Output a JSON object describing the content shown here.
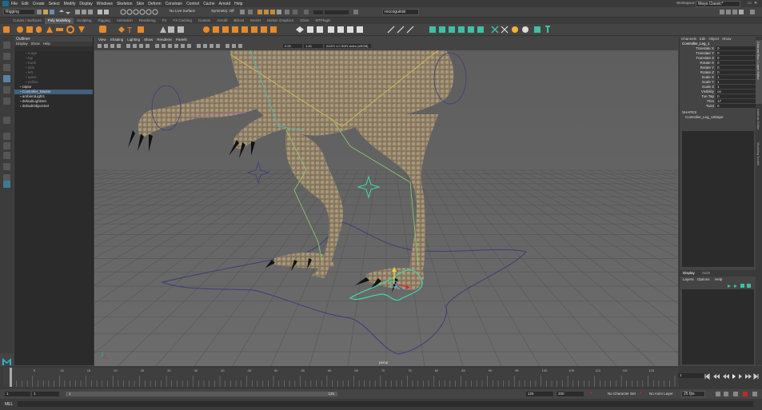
{
  "menubar": {
    "items": [
      "File",
      "Edit",
      "Create",
      "Select",
      "Modify",
      "Display",
      "Windows",
      "Skeleton",
      "Skin",
      "Deform",
      "Constrain",
      "Control",
      "Cache",
      "Arnold",
      "Help"
    ],
    "workspace_label": "Workspace:",
    "workspace_value": "Maya Classic*"
  },
  "statusline": {
    "mode": "Rigging",
    "live_surface": "No Live Surface",
    "symmetry": "Symmetry: Off",
    "render_user": "roccoguinisi"
  },
  "shelf": {
    "tabs": [
      "Curves / Surfaces",
      "Poly Modeling",
      "Sculpting",
      "Rigging",
      "Animation",
      "Rendering",
      "FX",
      "FX Caching",
      "Custom",
      "Arnold",
      "Bifrost",
      "MASH",
      "Motion Graphics",
      "XGen",
      "MTPlugin"
    ],
    "active_tab": "Poly Modeling"
  },
  "outliner": {
    "title": "Outliner",
    "menus": [
      "Display",
      "Show",
      "Help"
    ],
    "items": [
      {
        "label": "rcage",
        "style": "dim",
        "indent": 2
      },
      {
        "label": "tap",
        "style": "dim",
        "indent": 2
      },
      {
        "label": "trunk",
        "style": "dim",
        "indent": 2
      },
      {
        "label": "side",
        "style": "dim",
        "indent": 2
      },
      {
        "label": "left",
        "style": "dim",
        "indent": 2
      },
      {
        "label": "spine",
        "style": "dim",
        "indent": 2
      },
      {
        "label": "yellow",
        "style": "dim",
        "indent": 2
      },
      {
        "label": "raptor",
        "style": "normal",
        "indent": 1
      },
      {
        "label": "Controller_Master",
        "style": "sel",
        "indent": 1
      },
      {
        "label": "ambientLight1",
        "style": "normal",
        "indent": 1
      },
      {
        "label": "defaultLightSet",
        "style": "normal",
        "indent": 1
      },
      {
        "label": "defaultObjectSet",
        "style": "normal",
        "indent": 1
      }
    ]
  },
  "viewport": {
    "menus": [
      "View",
      "Shading",
      "Lighting",
      "Show",
      "Renderer",
      "Panels"
    ],
    "field_a": "0.00",
    "field_b": "1.00",
    "color_space": "ACES 1.0 SDR-video (sRGB)",
    "camera_label": "persp"
  },
  "channelbox": {
    "menus": [
      "Channels",
      "Edit",
      "Object",
      "Show"
    ],
    "object_name": "Controller_Leg_1",
    "channels": [
      {
        "name": "Translate X",
        "value": "0"
      },
      {
        "name": "Translate Y",
        "value": "0"
      },
      {
        "name": "Translate Z",
        "value": "0"
      },
      {
        "name": "Rotate X",
        "value": "0"
      },
      {
        "name": "Rotate Y",
        "value": "0"
      },
      {
        "name": "Rotate Z",
        "value": "0"
      },
      {
        "name": "Scale X",
        "value": "1"
      },
      {
        "name": "Scale Y",
        "value": "1"
      },
      {
        "name": "Scale Z",
        "value": "1"
      },
      {
        "name": "Visibility",
        "value": "on"
      },
      {
        "name": "Toe Tap",
        "value": "0"
      },
      {
        "name": "Flex",
        "value": "17"
      },
      {
        "name": "Twist",
        "value": "0"
      }
    ],
    "shapes_header": "SHAPES",
    "shape_name": "Controller_Leg_1Shape"
  },
  "layer_editor": {
    "tabs": [
      "Display",
      "Anim"
    ],
    "menus": [
      "Layers",
      "Options",
      "Help"
    ]
  },
  "side_tabs": [
    "Channel Box / Layer Editor",
    "Attribute Editor",
    "Modeling Toolkit"
  ],
  "timeline": {
    "current_frame": "1",
    "ticks": [
      "5",
      "10",
      "15",
      "20",
      "25",
      "30",
      "35",
      "40",
      "45",
      "50",
      "55",
      "60",
      "65",
      "70",
      "75",
      "80",
      "85",
      "90",
      "95",
      "100",
      "105",
      "110",
      "115",
      "120"
    ]
  },
  "rangebar": {
    "start": "1",
    "start_inner": "1",
    "slider_left": "1",
    "slider_right": "125",
    "end_inner": "125",
    "end": "200",
    "character_set": "No Character Set",
    "anim_layer": "No Anim Layer",
    "fps": "25 fps"
  },
  "cmdline": {
    "label": "MEL"
  }
}
